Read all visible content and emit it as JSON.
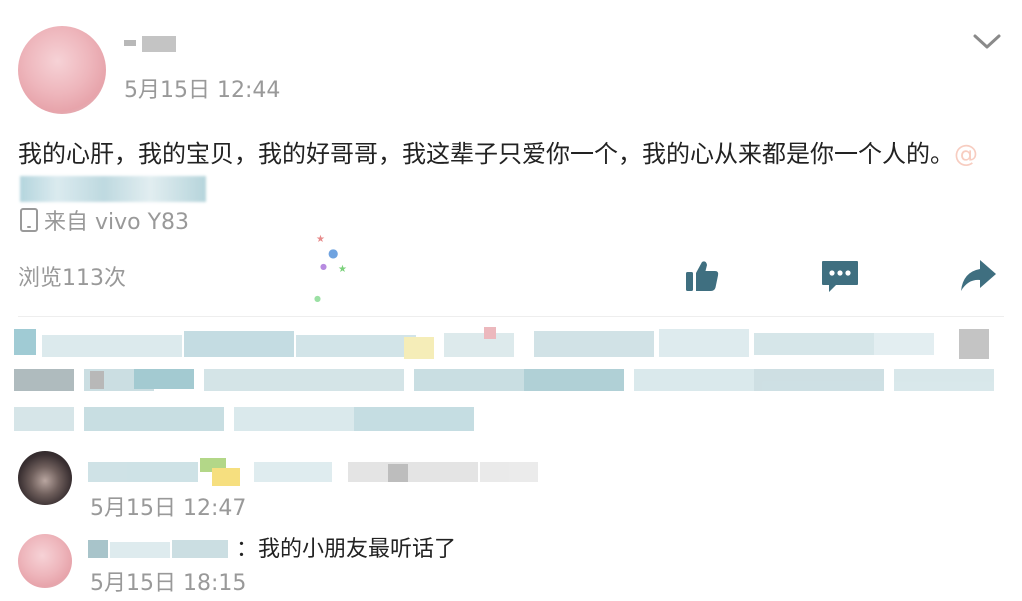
{
  "post": {
    "time": "5月15日 12:44",
    "text": "我的心肝，我的宝贝，我的好哥哥，我这辈子只爱你一个，我的心从来都是你一个人的。",
    "mention_prefix": "@",
    "device": "来自 vivo Y83",
    "views": "浏览113次"
  },
  "icons": {
    "menu": "chevron-down-icon",
    "device": "phone-icon",
    "like": "thumbs-up-icon",
    "comment": "comment-bubble-icon",
    "share": "share-arrow-icon"
  },
  "colors": {
    "text": "#222222",
    "muted": "#999999",
    "icon": "#3f6f80",
    "avatar_pink": "#eeb6bc"
  },
  "comments": [
    {
      "time": "5月15日 12:47"
    },
    {
      "separator": "：",
      "text": "我的小朋友最听话了",
      "time": "5月15日 18:15"
    }
  ]
}
